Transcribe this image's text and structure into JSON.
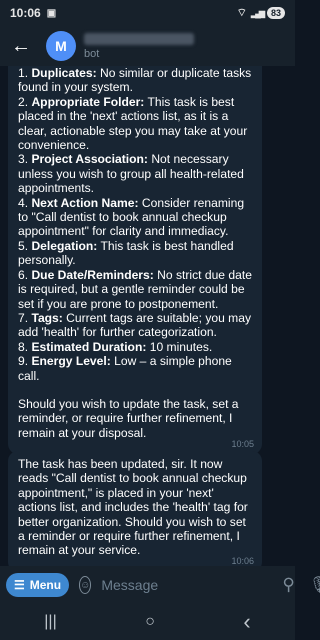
{
  "status_bar": {
    "time": "10:06",
    "screenshot_glyph": "▣",
    "wifi_glyph": "⌔",
    "signal_glyph": "▂▄▆",
    "battery": "83"
  },
  "header": {
    "back_glyph": "←",
    "avatar_letter": "M",
    "subtitle": "bot"
  },
  "messages": [
    {
      "lines": [
        {
          "num": "1. ",
          "bold": "Duplicates:",
          "text": " No similar or duplicate tasks found in your system."
        },
        {
          "num": "2. ",
          "bold": "Appropriate Folder:",
          "text": " This task is best placed in the 'next' actions list, as it is a clear, actionable step you may take at your convenience."
        },
        {
          "num": "3. ",
          "bold": "Project Association:",
          "text": " Not necessary unless you wish to group all health-related appointments."
        },
        {
          "num": "4. ",
          "bold": "Next Action Name:",
          "text": " Consider renaming to \"Call dentist to book annual checkup appointment\" for clarity and immediacy."
        },
        {
          "num": "5. ",
          "bold": "Delegation:",
          "text": " This task is best handled personally."
        },
        {
          "num": "6. ",
          "bold": "Due Date/Reminders:",
          "text": " No strict due date is required, but a gentle reminder could be set if you are prone to postponement."
        },
        {
          "num": "7. ",
          "bold": "Tags:",
          "text": " Current tags are suitable; you may add 'health' for further categorization."
        },
        {
          "num": "8. ",
          "bold": "Estimated Duration:",
          "text": " 10 minutes."
        },
        {
          "num": "9. ",
          "bold": "Energy Level:",
          "text": " Low – a simple phone call."
        }
      ],
      "closing": "Should you wish to update the task, set a reminder, or require further refinement, I remain at your disposal.",
      "time": "10:05"
    },
    {
      "body": "The task has been updated, sir. It now reads \"Call dentist to book annual checkup appointment,\" is placed in your 'next' actions list, and includes the 'health' tag for better organization. Should you wish to set a reminder or require further refinement, I remain at your service.",
      "time": "10:06"
    }
  ],
  "input_bar": {
    "menu_label": "Menu",
    "menu_glyph": "☰",
    "emoji_glyph": "☺",
    "placeholder": "Message",
    "attach_glyph": "⚲",
    "mic_glyph": "🎙"
  },
  "nav": {
    "recents": "|||",
    "home": "○",
    "back": "‹"
  },
  "colors": {
    "background": "#0e1621",
    "bubble": "#182533",
    "header": "#17212b",
    "accent": "#3e88d0",
    "avatar": "#4f8ff7"
  }
}
